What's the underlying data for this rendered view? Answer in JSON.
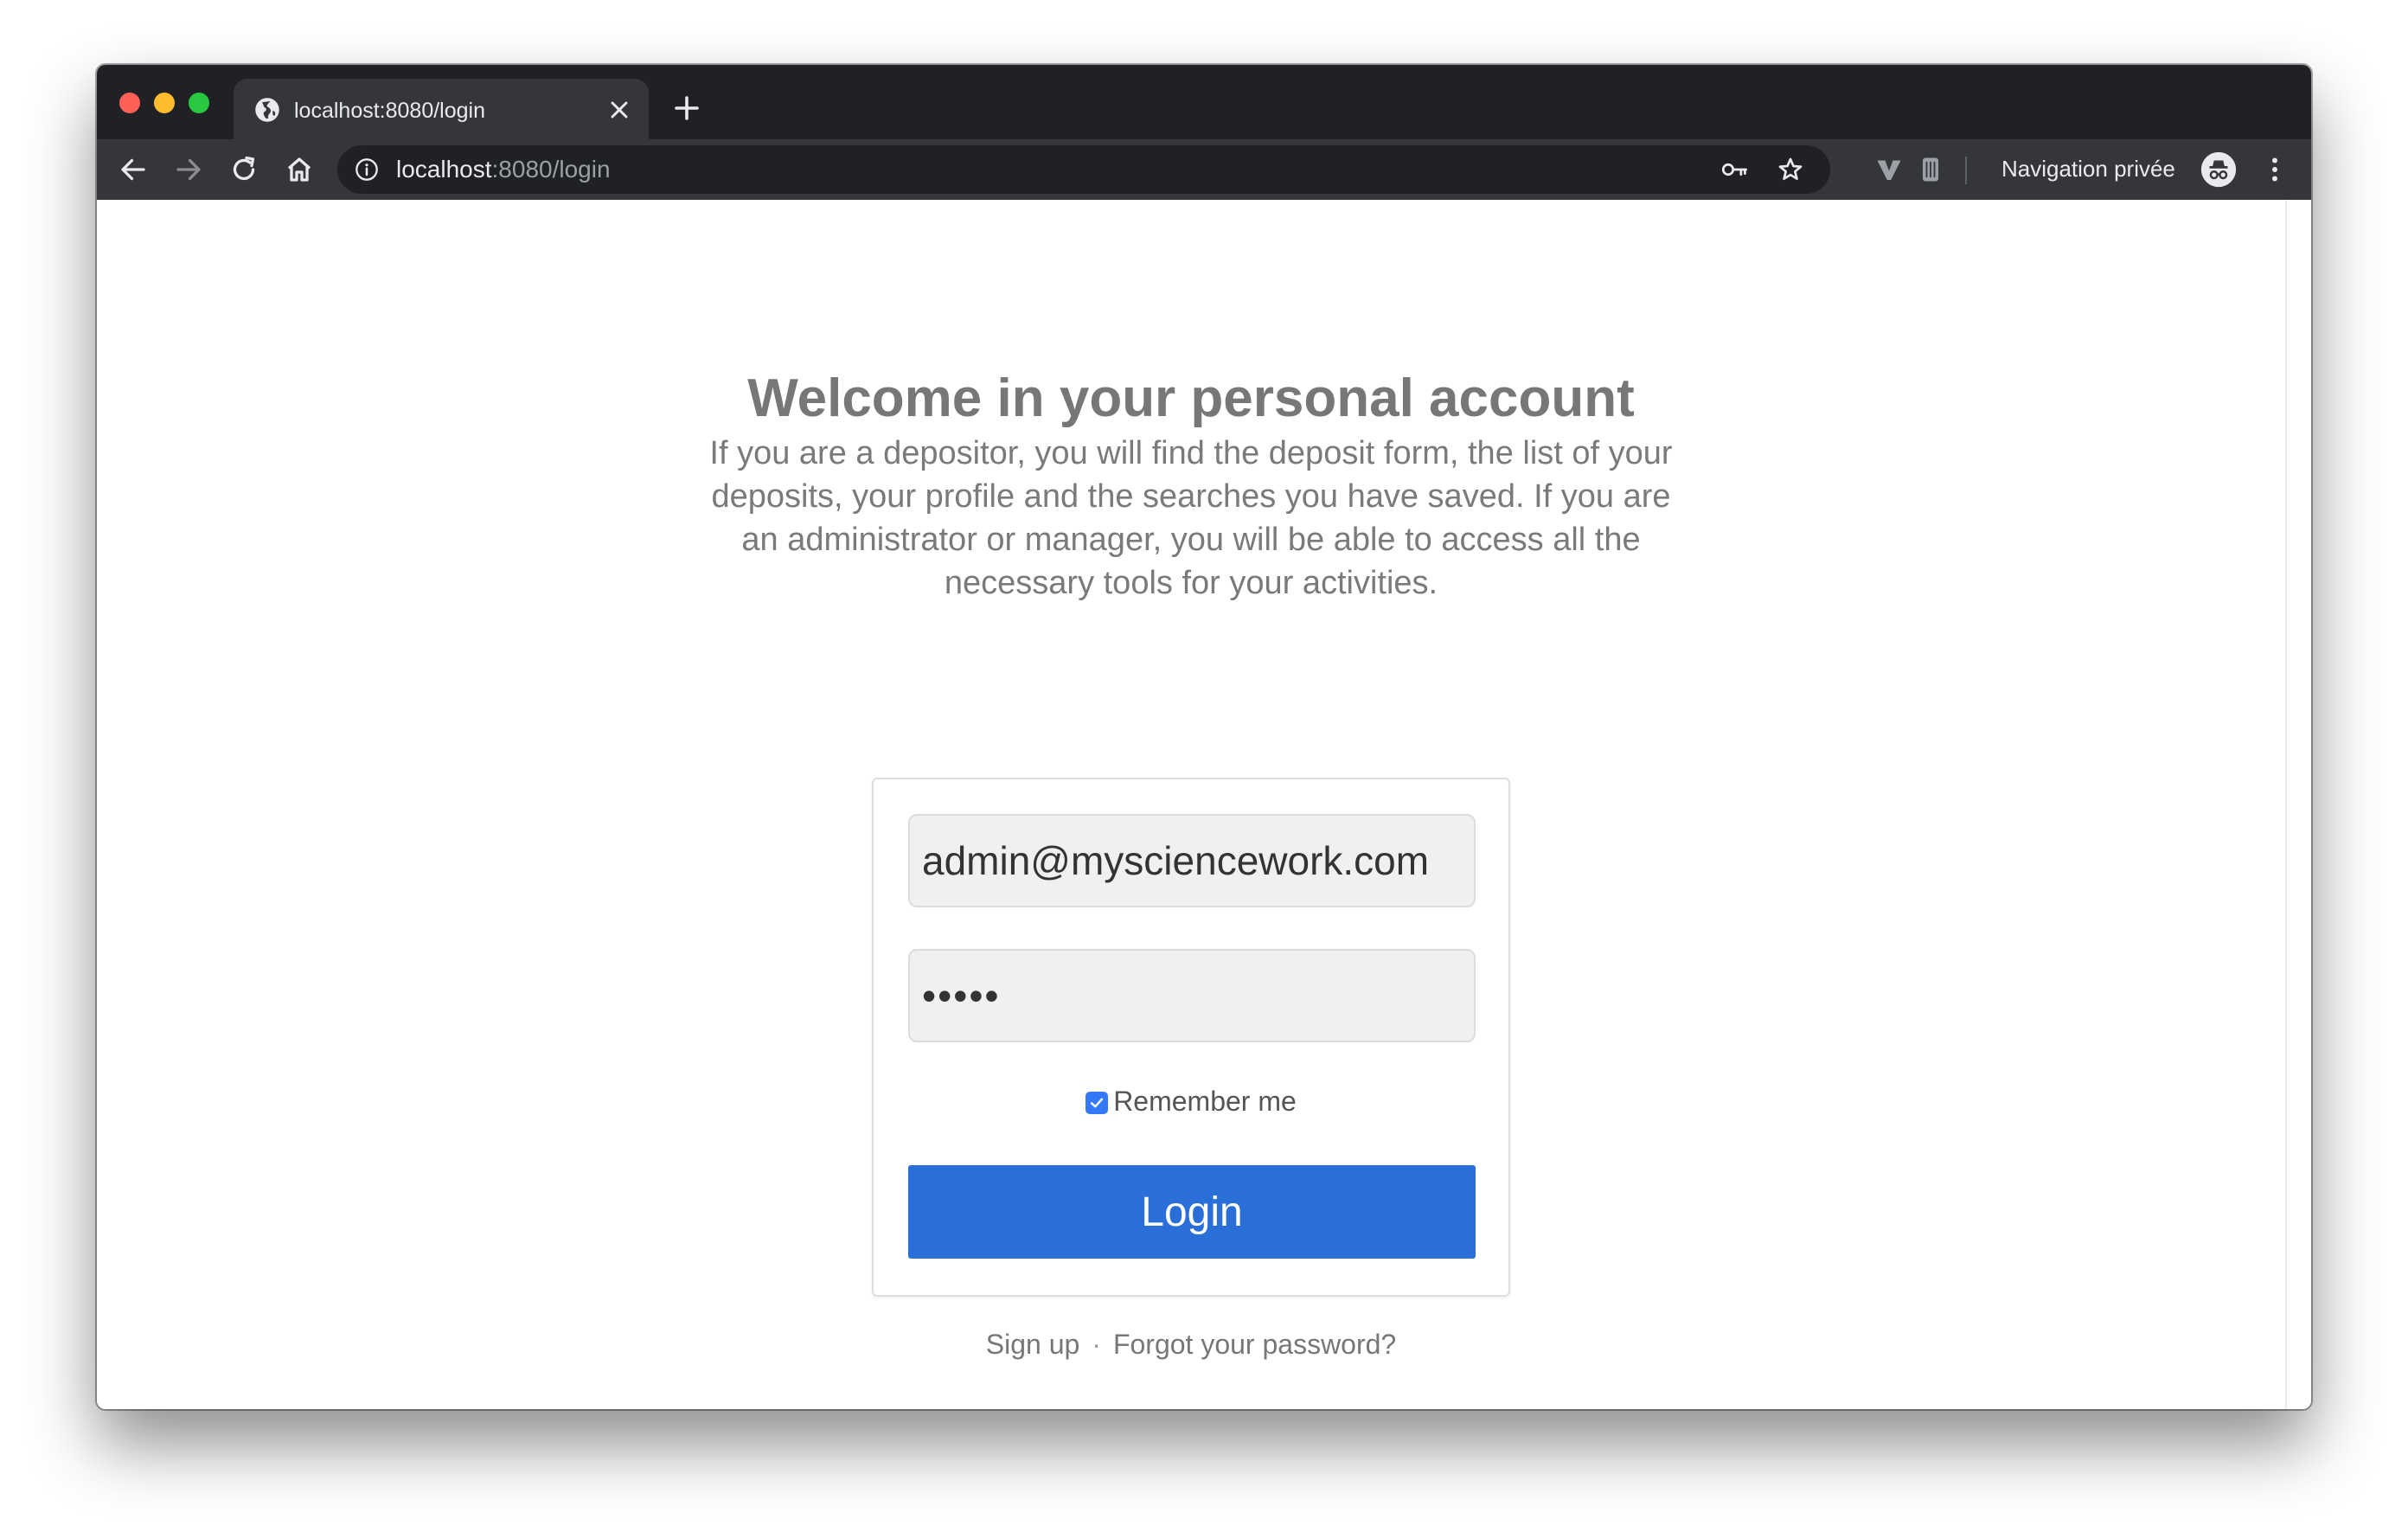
{
  "browser": {
    "tab": {
      "title": "localhost:8080/login",
      "favicon": "globe-icon"
    },
    "address_bar": {
      "host": "localhost",
      "path": ":8080/login"
    },
    "incognito_label": "Navigation privée",
    "icons": {
      "back": "arrow-left-icon",
      "forward": "arrow-right-icon",
      "reload": "reload-icon",
      "home": "home-icon",
      "info": "info-icon",
      "key": "key-icon",
      "bookmark": "star-icon",
      "extension_1": "vivaldi-v-icon",
      "extension_2": "storage-icon",
      "incognito": "incognito-icon",
      "menu": "more-vertical-icon"
    }
  },
  "page": {
    "heading": "Welcome in your personal account",
    "intro": "If you are a depositor, you will find the deposit form, the list of your deposits, your profile and the searches you have saved. If you are an administrator or manager, you will be able to access all the necessary tools for your activities.",
    "form": {
      "email_value": "admin@mysciencework.com",
      "password_value": "•••••",
      "remember_label": "Remember me",
      "remember_checked": true,
      "login_label": "Login"
    },
    "links": {
      "signup": "Sign up",
      "separator": "·",
      "forgot": "Forgot your password?"
    }
  },
  "colors": {
    "chrome_dark": "#202124",
    "chrome_toolbar": "#35363a",
    "primary_button": "#2a6fd8",
    "checkbox": "#3478f6",
    "text_muted": "#777777"
  }
}
